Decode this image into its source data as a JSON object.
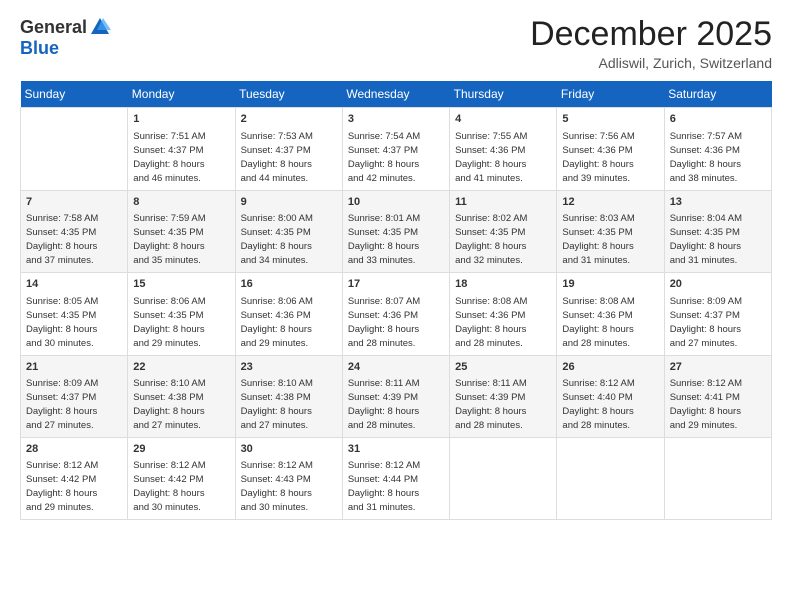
{
  "header": {
    "logo_general": "General",
    "logo_blue": "Blue",
    "title": "December 2025",
    "subtitle": "Adliswil, Zurich, Switzerland"
  },
  "days_of_week": [
    "Sunday",
    "Monday",
    "Tuesday",
    "Wednesday",
    "Thursday",
    "Friday",
    "Saturday"
  ],
  "weeks": [
    [
      {
        "day": "",
        "content": ""
      },
      {
        "day": "1",
        "content": "Sunrise: 7:51 AM\nSunset: 4:37 PM\nDaylight: 8 hours\nand 46 minutes."
      },
      {
        "day": "2",
        "content": "Sunrise: 7:53 AM\nSunset: 4:37 PM\nDaylight: 8 hours\nand 44 minutes."
      },
      {
        "day": "3",
        "content": "Sunrise: 7:54 AM\nSunset: 4:37 PM\nDaylight: 8 hours\nand 42 minutes."
      },
      {
        "day": "4",
        "content": "Sunrise: 7:55 AM\nSunset: 4:36 PM\nDaylight: 8 hours\nand 41 minutes."
      },
      {
        "day": "5",
        "content": "Sunrise: 7:56 AM\nSunset: 4:36 PM\nDaylight: 8 hours\nand 39 minutes."
      },
      {
        "day": "6",
        "content": "Sunrise: 7:57 AM\nSunset: 4:36 PM\nDaylight: 8 hours\nand 38 minutes."
      }
    ],
    [
      {
        "day": "7",
        "content": "Sunrise: 7:58 AM\nSunset: 4:35 PM\nDaylight: 8 hours\nand 37 minutes."
      },
      {
        "day": "8",
        "content": "Sunrise: 7:59 AM\nSunset: 4:35 PM\nDaylight: 8 hours\nand 35 minutes."
      },
      {
        "day": "9",
        "content": "Sunrise: 8:00 AM\nSunset: 4:35 PM\nDaylight: 8 hours\nand 34 minutes."
      },
      {
        "day": "10",
        "content": "Sunrise: 8:01 AM\nSunset: 4:35 PM\nDaylight: 8 hours\nand 33 minutes."
      },
      {
        "day": "11",
        "content": "Sunrise: 8:02 AM\nSunset: 4:35 PM\nDaylight: 8 hours\nand 32 minutes."
      },
      {
        "day": "12",
        "content": "Sunrise: 8:03 AM\nSunset: 4:35 PM\nDaylight: 8 hours\nand 31 minutes."
      },
      {
        "day": "13",
        "content": "Sunrise: 8:04 AM\nSunset: 4:35 PM\nDaylight: 8 hours\nand 31 minutes."
      }
    ],
    [
      {
        "day": "14",
        "content": "Sunrise: 8:05 AM\nSunset: 4:35 PM\nDaylight: 8 hours\nand 30 minutes."
      },
      {
        "day": "15",
        "content": "Sunrise: 8:06 AM\nSunset: 4:35 PM\nDaylight: 8 hours\nand 29 minutes."
      },
      {
        "day": "16",
        "content": "Sunrise: 8:06 AM\nSunset: 4:36 PM\nDaylight: 8 hours\nand 29 minutes."
      },
      {
        "day": "17",
        "content": "Sunrise: 8:07 AM\nSunset: 4:36 PM\nDaylight: 8 hours\nand 28 minutes."
      },
      {
        "day": "18",
        "content": "Sunrise: 8:08 AM\nSunset: 4:36 PM\nDaylight: 8 hours\nand 28 minutes."
      },
      {
        "day": "19",
        "content": "Sunrise: 8:08 AM\nSunset: 4:36 PM\nDaylight: 8 hours\nand 28 minutes."
      },
      {
        "day": "20",
        "content": "Sunrise: 8:09 AM\nSunset: 4:37 PM\nDaylight: 8 hours\nand 27 minutes."
      }
    ],
    [
      {
        "day": "21",
        "content": "Sunrise: 8:09 AM\nSunset: 4:37 PM\nDaylight: 8 hours\nand 27 minutes."
      },
      {
        "day": "22",
        "content": "Sunrise: 8:10 AM\nSunset: 4:38 PM\nDaylight: 8 hours\nand 27 minutes."
      },
      {
        "day": "23",
        "content": "Sunrise: 8:10 AM\nSunset: 4:38 PM\nDaylight: 8 hours\nand 27 minutes."
      },
      {
        "day": "24",
        "content": "Sunrise: 8:11 AM\nSunset: 4:39 PM\nDaylight: 8 hours\nand 28 minutes."
      },
      {
        "day": "25",
        "content": "Sunrise: 8:11 AM\nSunset: 4:39 PM\nDaylight: 8 hours\nand 28 minutes."
      },
      {
        "day": "26",
        "content": "Sunrise: 8:12 AM\nSunset: 4:40 PM\nDaylight: 8 hours\nand 28 minutes."
      },
      {
        "day": "27",
        "content": "Sunrise: 8:12 AM\nSunset: 4:41 PM\nDaylight: 8 hours\nand 29 minutes."
      }
    ],
    [
      {
        "day": "28",
        "content": "Sunrise: 8:12 AM\nSunset: 4:42 PM\nDaylight: 8 hours\nand 29 minutes."
      },
      {
        "day": "29",
        "content": "Sunrise: 8:12 AM\nSunset: 4:42 PM\nDaylight: 8 hours\nand 30 minutes."
      },
      {
        "day": "30",
        "content": "Sunrise: 8:12 AM\nSunset: 4:43 PM\nDaylight: 8 hours\nand 30 minutes."
      },
      {
        "day": "31",
        "content": "Sunrise: 8:12 AM\nSunset: 4:44 PM\nDaylight: 8 hours\nand 31 minutes."
      },
      {
        "day": "",
        "content": ""
      },
      {
        "day": "",
        "content": ""
      },
      {
        "day": "",
        "content": ""
      }
    ]
  ]
}
